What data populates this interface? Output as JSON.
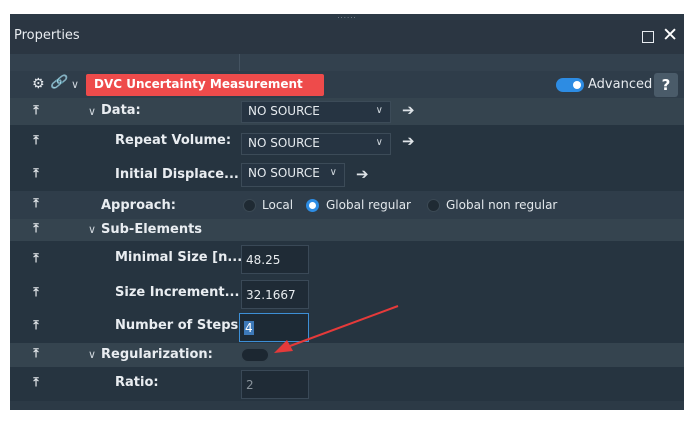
{
  "window": {
    "title": "Properties",
    "grip_glyph": "......",
    "close_glyph": "✕",
    "max_icon": "square-icon"
  },
  "header": {
    "name_value": "DVC Uncertainty Measurement",
    "advanced_label": "Advanced",
    "advanced_on": true,
    "help_label": "?",
    "colors": {
      "name_bg": "#ee4b4b",
      "accent": "#2d8ce3"
    }
  },
  "icons": {
    "pin": "⤒",
    "chevron": "∨",
    "arrow": "➔",
    "gear": "⚙",
    "link": "🔗",
    "dropdown": "∨"
  },
  "rows": {
    "data": {
      "label": "Data:",
      "value": "NO SOURCE"
    },
    "repeat_volume": {
      "label": "Repeat Volume:",
      "value": "NO SOURCE"
    },
    "initial_displacement": {
      "label": "Initial Displace...",
      "value": "NO SOURCE"
    },
    "approach": {
      "label": "Approach:",
      "options": [
        "Local",
        "Global regular",
        "Global non regular"
      ],
      "selected": "Global regular"
    },
    "sub_elements": {
      "label": "Sub-Elements"
    },
    "minimal_size": {
      "label": "Minimal Size [n...",
      "value": "48.25"
    },
    "size_increment": {
      "label": "Size Increment...",
      "value": "32.1667"
    },
    "number_of_steps": {
      "label": "Number of Steps:",
      "value": "4"
    },
    "regularization": {
      "label": "Regularization:",
      "enabled": false
    },
    "ratio": {
      "label": "Ratio:",
      "value": "2"
    }
  }
}
